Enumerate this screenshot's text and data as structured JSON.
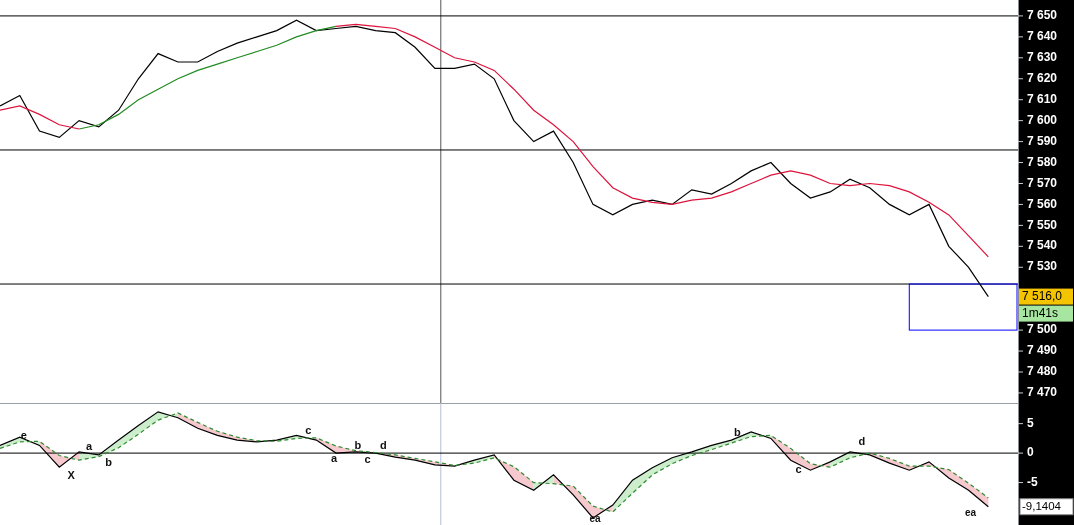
{
  "price_panel": {
    "chart_data": {
      "type": "line",
      "ylim": [
        7465.2,
        7657.6
      ],
      "yticks": [
        {
          "value": 7650,
          "label": "7 650"
        },
        {
          "value": 7640,
          "label": "7 640"
        },
        {
          "value": 7630,
          "label": "7 630"
        },
        {
          "value": 7620,
          "label": "7 620"
        },
        {
          "value": 7610,
          "label": "7 610"
        },
        {
          "value": 7600,
          "label": "7 600"
        },
        {
          "value": 7590,
          "label": "7 590"
        },
        {
          "value": 7580,
          "label": "7 580"
        },
        {
          "value": 7570,
          "label": "7 570"
        },
        {
          "value": 7560,
          "label": "7 560"
        },
        {
          "value": 7550,
          "label": "7 550"
        },
        {
          "value": 7540,
          "label": "7 540"
        },
        {
          "value": 7530,
          "label": "7 530"
        },
        {
          "value": 7500,
          "label": "7 500"
        },
        {
          "value": 7490,
          "label": "7 490"
        },
        {
          "value": 7480,
          "label": "7 480"
        },
        {
          "value": 7470,
          "label": "7 470"
        }
      ],
      "series": [
        {
          "color": "#000000",
          "values": [
            7607,
            7612,
            7595,
            7592,
            7600,
            7597,
            7605,
            7620,
            7632,
            7628,
            7628,
            7633,
            7637,
            7640,
            7643,
            7648,
            7643,
            7644,
            7645,
            7643,
            7642,
            7635,
            7625,
            7625,
            7627,
            7620,
            7600,
            7590,
            7595,
            7580,
            7560,
            7555,
            7560,
            7562,
            7560,
            7567,
            7565,
            7570,
            7576,
            7580,
            7570,
            7563,
            7566,
            7572,
            7568,
            7560,
            7555,
            7560,
            7540,
            7530,
            7516
          ]
        },
        {
          "color": "#dc143c",
          "values": [
            7605,
            7607,
            7603,
            7598,
            7596,
            null,
            null,
            null,
            null,
            null,
            null,
            null,
            null,
            null,
            null,
            null,
            null,
            7645,
            7646,
            7645,
            7644,
            7640,
            7635,
            7630,
            7628,
            7624,
            7615,
            7605,
            7598,
            7590,
            7578,
            7568,
            7563,
            7561,
            7560,
            7562,
            7563,
            7566,
            7570,
            7574,
            7576,
            7574,
            7570,
            7569,
            7570,
            7569,
            7566,
            7561,
            7555,
            7545,
            7535
          ]
        },
        {
          "color": "#228b22",
          "values": [
            null,
            null,
            null,
            null,
            7596,
            7598,
            7603,
            7610,
            7615,
            7620,
            7624,
            7627,
            7630,
            7633,
            7636,
            7640,
            7643,
            7645,
            null,
            null,
            null,
            null,
            null,
            null,
            null,
            null,
            null,
            null,
            null,
            null,
            null,
            null,
            null,
            null,
            null,
            null,
            null,
            null,
            null,
            null,
            null,
            null,
            null,
            null,
            null,
            null,
            null,
            null,
            null,
            null,
            null
          ]
        }
      ],
      "ref_lines": [
        {
          "axis": "y",
          "value": 7650
        },
        {
          "axis": "y",
          "value": 7586
        },
        {
          "axis": "y",
          "value": 7522
        }
      ]
    },
    "price_badge": "7 516,0",
    "timer_badge": "1m41s"
  },
  "oscillator_panel": {
    "chart_data": {
      "type": "line",
      "ylim": [
        -12.2,
        8.5
      ],
      "yticks": [
        5,
        0,
        -5
      ],
      "series": [
        {
          "color": "#000000",
          "values": [
            1.3,
            2.7,
            1.3,
            -2.4,
            0.2,
            -0.3,
            2.2,
            4.7,
            7,
            6,
            4.2,
            3,
            2.2,
            1.9,
            2.2,
            3,
            2.2,
            0,
            0.2,
            0,
            -0.7,
            -1.2,
            -2,
            -2.2,
            -1.2,
            -0.3,
            -4.6,
            -6.3,
            -3.7,
            -7.1,
            -11,
            -8.8,
            -4.6,
            -2.5,
            -0.8,
            0.2,
            1.3,
            2.2,
            3.6,
            2.5,
            -1.2,
            -2.9,
            -1.5,
            0.2,
            -0.3,
            -1.7,
            -2.9,
            -1.5,
            -4.2,
            -6.3,
            -9.1
          ]
        },
        {
          "color": "#2e8b2e",
          "line_style": "dashed",
          "values": [
            0.8,
            1.9,
            2,
            -0.4,
            -1.2,
            -0.6,
            0.9,
            3.2,
            5.6,
            6.8,
            5.2,
            3.7,
            2.7,
            2.1,
            2,
            2.5,
            2.6,
            1.2,
            0.4,
            0.1,
            -0.3,
            -0.9,
            -1.5,
            -2.1,
            -1.7,
            -0.8,
            -2.3,
            -5,
            -5.2,
            -5.6,
            -9,
            -10,
            -6.8,
            -3.7,
            -1.8,
            -0.4,
            0.6,
            1.7,
            2.8,
            3,
            0.8,
            -1.8,
            -2.4,
            -0.8,
            0,
            -0.9,
            -2.2,
            -2.2,
            -2.8,
            -5.1,
            -7.6
          ]
        }
      ],
      "ref_lines": [
        {
          "axis": "y",
          "value": 0
        }
      ],
      "annotations": [
        "e",
        "X",
        "a",
        "b",
        "c",
        "a",
        "b",
        "c",
        "d",
        "ea",
        "b",
        "c",
        "d",
        "ea"
      ]
    },
    "value_badge": "-9,1404"
  }
}
